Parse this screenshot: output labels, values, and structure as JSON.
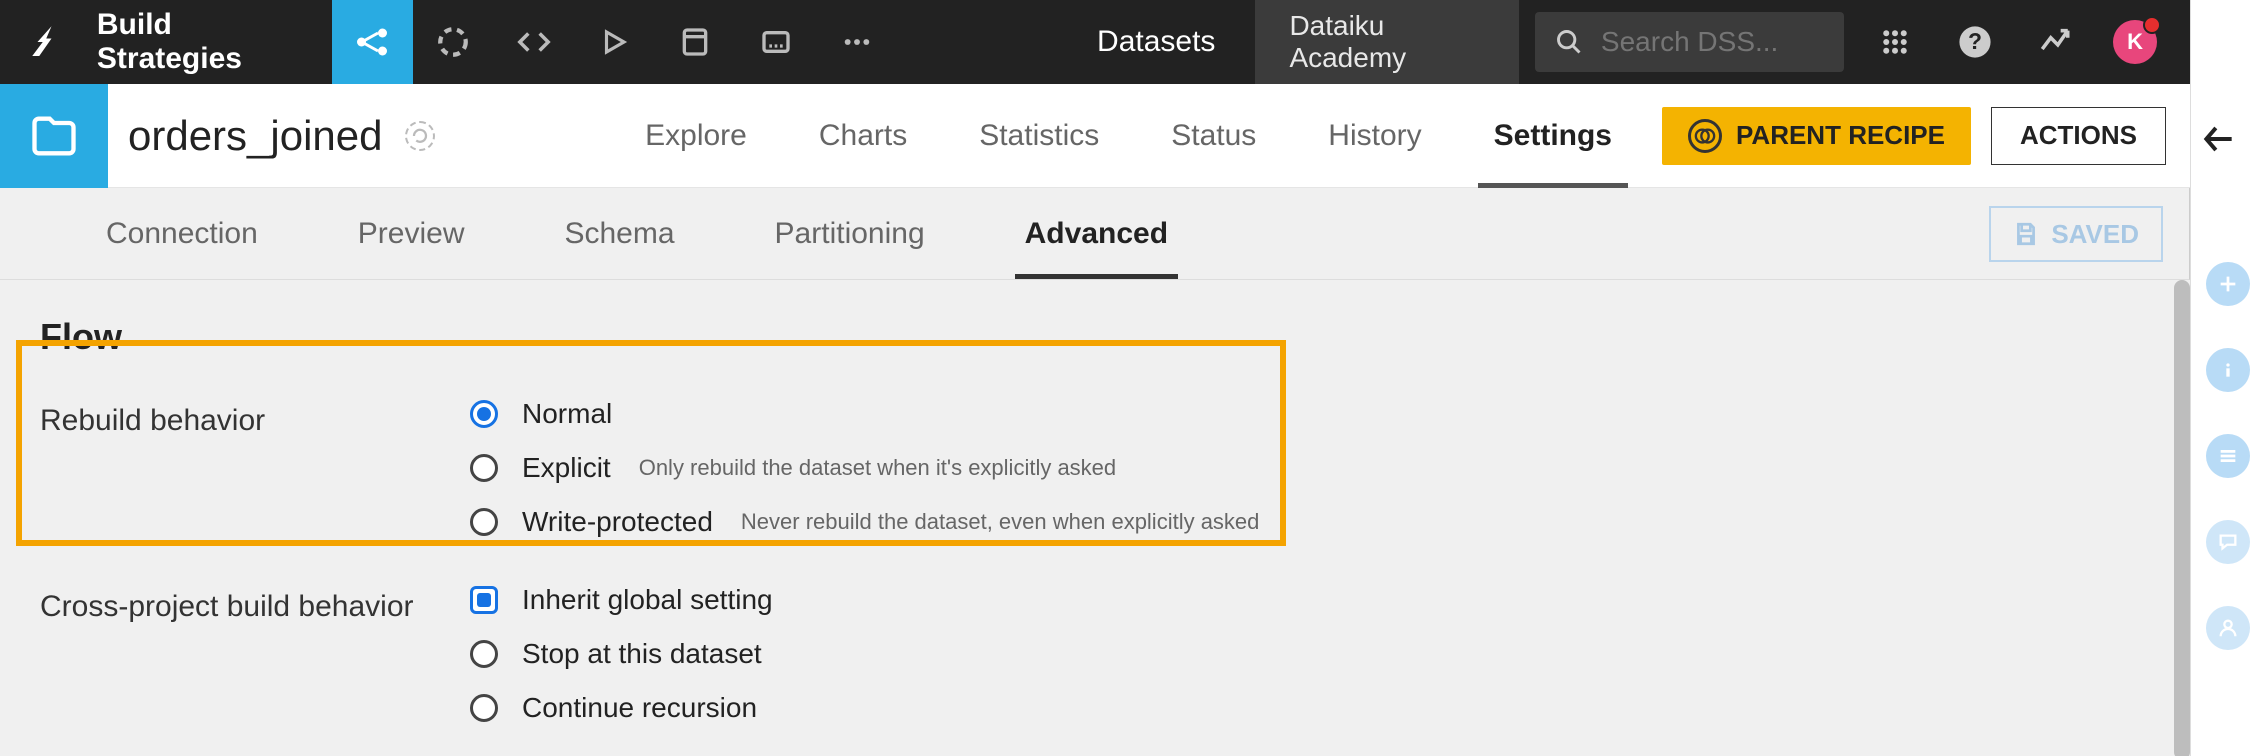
{
  "topbar": {
    "project_title": "Build Strategies",
    "nav_label": "Datasets",
    "academy_label": "Dataiku Academy",
    "search_placeholder": "Search DSS...",
    "avatar_letter": "K"
  },
  "dataset": {
    "name": "orders_joined",
    "tabs": {
      "explore": "Explore",
      "charts": "Charts",
      "statistics": "Statistics",
      "status": "Status",
      "history": "History",
      "settings": "Settings"
    },
    "parent_recipe_label": "PARENT RECIPE",
    "actions_label": "ACTIONS"
  },
  "subtabs": {
    "connection": "Connection",
    "preview": "Preview",
    "schema": "Schema",
    "partitioning": "Partitioning",
    "advanced": "Advanced",
    "saved_label": "SAVED"
  },
  "flow": {
    "section_title": "Flow",
    "rebuild": {
      "label": "Rebuild behavior",
      "options": {
        "normal": {
          "label": "Normal",
          "hint": ""
        },
        "explicit": {
          "label": "Explicit",
          "hint": "Only rebuild the dataset when it's explicitly asked"
        },
        "write_protected": {
          "label": "Write-protected",
          "hint": "Never rebuild the dataset, even when explicitly asked"
        }
      },
      "selected": "normal"
    },
    "cross_project": {
      "label": "Cross-project build behavior",
      "options": {
        "inherit": {
          "label": "Inherit global setting"
        },
        "stop": {
          "label": "Stop at this dataset"
        },
        "continue": {
          "label": "Continue recursion"
        }
      },
      "selected": "inherit"
    }
  }
}
